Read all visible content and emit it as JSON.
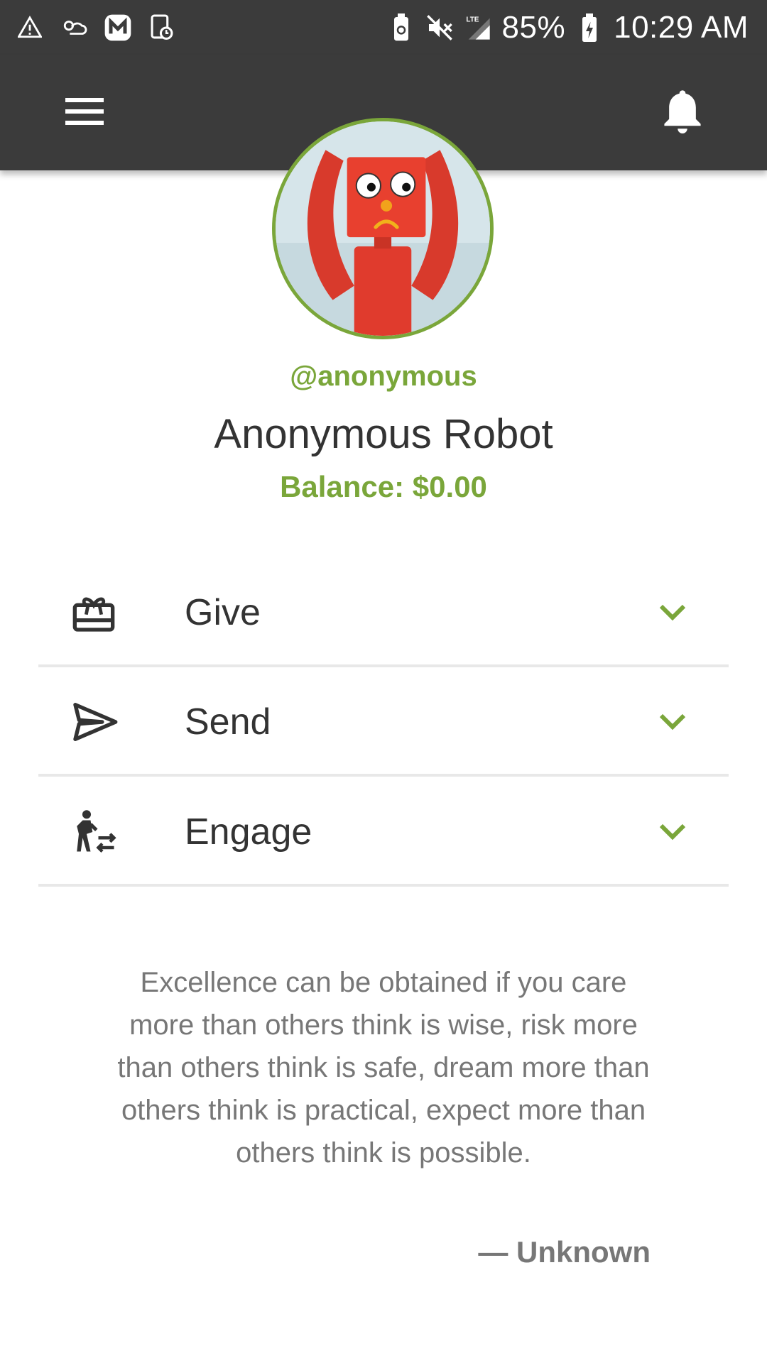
{
  "status_bar": {
    "battery": "85%",
    "time": "10:29 AM",
    "network": "LTE"
  },
  "profile": {
    "username": "@anonymous",
    "name": "Anonymous Robot",
    "balance": "Balance: $0.00"
  },
  "actions": [
    {
      "label": "Give",
      "icon": "gift-card-icon"
    },
    {
      "label": "Send",
      "icon": "send-icon"
    },
    {
      "label": "Engage",
      "icon": "engage-icon"
    }
  ],
  "quote": {
    "text": "Excellence can be obtained if you care more than others think is wise, risk more than others think is safe, dream more than others think is practical, expect more than others think is possible.",
    "author": "— Unknown"
  },
  "colors": {
    "accent": "#7aa63a",
    "toolbar": "#3b3b3b"
  }
}
